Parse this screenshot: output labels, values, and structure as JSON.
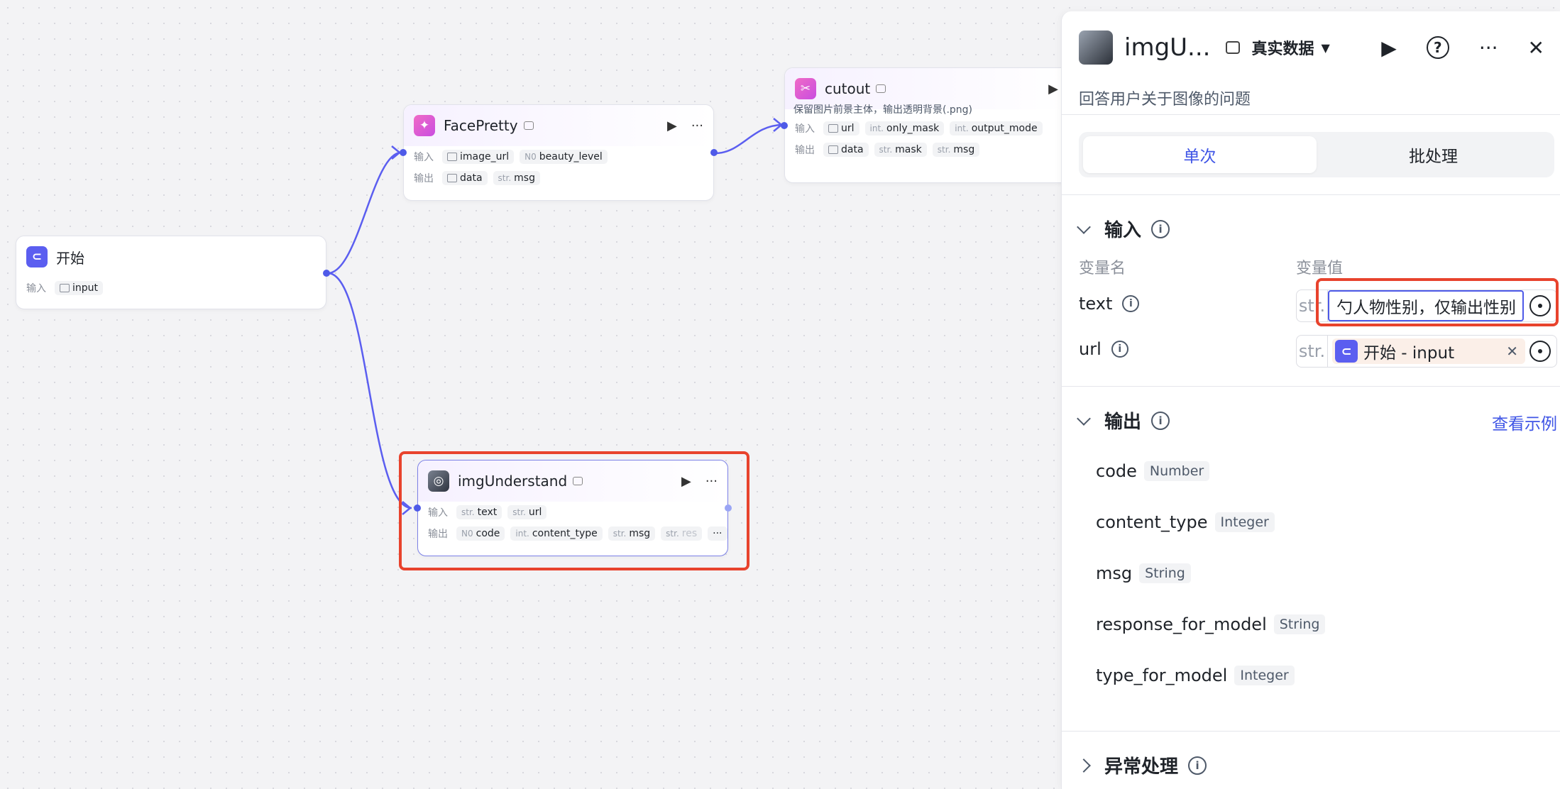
{
  "canvas": {
    "start_node": {
      "title": "开始",
      "input_label": "输入",
      "inputs": [
        "input"
      ]
    },
    "facepretty_node": {
      "title": "FacePretty",
      "input_label": "输入",
      "output_label": "输出",
      "inputs": [
        {
          "type": "",
          "name": "image_url"
        },
        {
          "type": "N0",
          "name": "beauty_level"
        }
      ],
      "outputs": [
        {
          "type": "",
          "name": "data"
        },
        {
          "type": "str.",
          "name": "msg"
        }
      ]
    },
    "cutout_node": {
      "title": "cutout",
      "description": "保留图片前景主体，输出透明背景(.png)",
      "input_label": "输入",
      "output_label": "输出",
      "inputs": [
        {
          "type": "",
          "name": "url"
        },
        {
          "type": "int.",
          "name": "only_mask"
        },
        {
          "type": "int.",
          "name": "output_mode"
        }
      ],
      "outputs": [
        {
          "type": "",
          "name": "data"
        },
        {
          "type": "str.",
          "name": "mask"
        },
        {
          "type": "str.",
          "name": "msg"
        }
      ]
    },
    "imgunderstand_node": {
      "title": "imgUnderstand",
      "input_label": "输入",
      "output_label": "输出",
      "inputs": [
        {
          "type": "str.",
          "name": "text"
        },
        {
          "type": "str.",
          "name": "url"
        }
      ],
      "outputs": [
        {
          "type": "N0",
          "name": "code"
        },
        {
          "type": "int.",
          "name": "content_type"
        },
        {
          "type": "str.",
          "name": "msg"
        },
        {
          "type": "str.",
          "name": "res"
        }
      ],
      "more": "···"
    }
  },
  "panel": {
    "title": "imgU...",
    "mode": "真实数据",
    "description": "回答用户关于图像的问题",
    "tabs": [
      "单次",
      "批处理"
    ],
    "input_section": {
      "title": "输入",
      "col_name": "变量名",
      "col_value": "变量值",
      "vars": [
        {
          "name": "text",
          "type": "str.",
          "value": "勺人物性别，仅输出性别"
        },
        {
          "name": "url",
          "type": "str.",
          "ref_text": "开始 - input"
        }
      ]
    },
    "output_section": {
      "title": "输出",
      "example_link": "查看示例",
      "items": [
        {
          "name": "code",
          "type": "Number"
        },
        {
          "name": "content_type",
          "type": "Integer"
        },
        {
          "name": "msg",
          "type": "String"
        },
        {
          "name": "response_for_model",
          "type": "String"
        },
        {
          "name": "type_for_model",
          "type": "Integer"
        }
      ]
    },
    "error_section": {
      "title": "异常处理"
    }
  },
  "colors": {
    "accent": "#3f55e6",
    "edge": "#5b5ef0",
    "highlight": "#e8432d"
  }
}
